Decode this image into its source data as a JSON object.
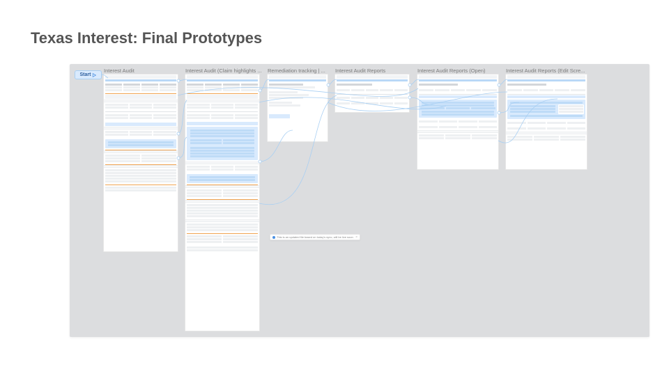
{
  "title": "Texas Interest: Final Prototypes",
  "start_label": "Start",
  "frames": [
    {
      "id": "f1",
      "title": "Interest Audit"
    },
    {
      "id": "f2",
      "title": "Interest Audit (Claim highlights ..."
    },
    {
      "id": "f3",
      "title": "Remediation tracking | ..."
    },
    {
      "id": "f4",
      "title": "Interest Audit Reports"
    },
    {
      "id": "f5",
      "title": "Interest Audit Reports (Open)"
    },
    {
      "id": "f6",
      "title": "Interest Audit Reports (Edit Scre..."
    }
  ],
  "comment_text": "This is an updated file based on today's sync, will be live soon"
}
